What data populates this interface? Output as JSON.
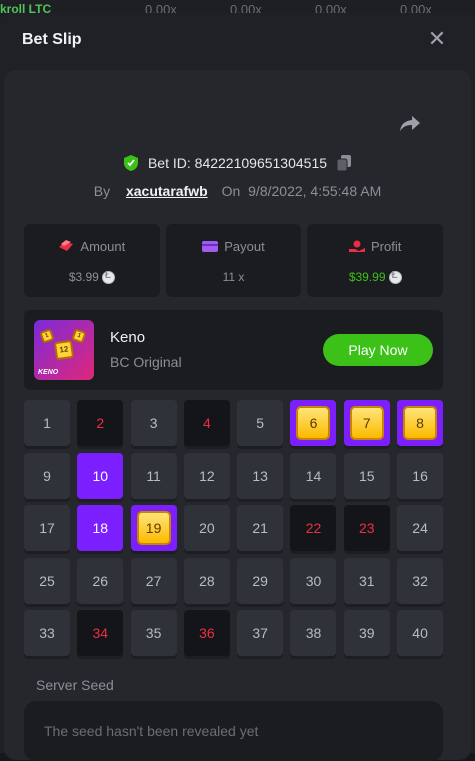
{
  "background": {
    "left_text": "kroll LTC",
    "multipliers": [
      "0.00x",
      "0.00x",
      "0.00x",
      "0.00x"
    ]
  },
  "modal": {
    "title": "Bet Slip",
    "close_icon": "close-icon"
  },
  "bet": {
    "id_label": "Bet ID: 84222109651304515",
    "by_label": "By",
    "user": "xacutarafwb",
    "on_label": "On",
    "datetime": "9/8/2022, 4:55:48 AM"
  },
  "stats": {
    "amount_label": "Amount",
    "amount_value": "$3.99",
    "payout_label": "Payout",
    "payout_value": "11 x",
    "profit_label": "Profit",
    "profit_value": "$39.99"
  },
  "game": {
    "name": "Keno",
    "subtitle": "BC Original",
    "play_label": "Play Now",
    "icon_text": "KENO",
    "icon_die_1": "12",
    "icon_die_2": "1",
    "icon_die_3": "1"
  },
  "grid": {
    "cells": [
      {
        "n": "1",
        "state": "normal"
      },
      {
        "n": "2",
        "state": "lost"
      },
      {
        "n": "3",
        "state": "normal"
      },
      {
        "n": "4",
        "state": "lost"
      },
      {
        "n": "5",
        "state": "normal"
      },
      {
        "n": "6",
        "state": "hit"
      },
      {
        "n": "7",
        "state": "hit"
      },
      {
        "n": "8",
        "state": "hit"
      },
      {
        "n": "9",
        "state": "normal"
      },
      {
        "n": "10",
        "state": "picked"
      },
      {
        "n": "11",
        "state": "normal"
      },
      {
        "n": "12",
        "state": "normal"
      },
      {
        "n": "13",
        "state": "normal"
      },
      {
        "n": "14",
        "state": "normal"
      },
      {
        "n": "15",
        "state": "normal"
      },
      {
        "n": "16",
        "state": "normal"
      },
      {
        "n": "17",
        "state": "normal"
      },
      {
        "n": "18",
        "state": "picked"
      },
      {
        "n": "19",
        "state": "hit"
      },
      {
        "n": "20",
        "state": "normal"
      },
      {
        "n": "21",
        "state": "normal"
      },
      {
        "n": "22",
        "state": "lost"
      },
      {
        "n": "23",
        "state": "lost"
      },
      {
        "n": "24",
        "state": "normal"
      },
      {
        "n": "25",
        "state": "normal"
      },
      {
        "n": "26",
        "state": "normal"
      },
      {
        "n": "27",
        "state": "normal"
      },
      {
        "n": "28",
        "state": "normal"
      },
      {
        "n": "29",
        "state": "normal"
      },
      {
        "n": "30",
        "state": "normal"
      },
      {
        "n": "31",
        "state": "normal"
      },
      {
        "n": "32",
        "state": "normal"
      },
      {
        "n": "33",
        "state": "normal"
      },
      {
        "n": "34",
        "state": "lost"
      },
      {
        "n": "35",
        "state": "normal"
      },
      {
        "n": "36",
        "state": "lost"
      },
      {
        "n": "37",
        "state": "normal"
      },
      {
        "n": "38",
        "state": "normal"
      },
      {
        "n": "39",
        "state": "normal"
      },
      {
        "n": "40",
        "state": "normal"
      }
    ]
  },
  "seed": {
    "label": "Server Seed",
    "placeholder": "The seed hasn't been revealed yet"
  },
  "colors": {
    "accent_green": "#3bc117",
    "picked_purple": "#7b1fff",
    "lost_red": "#ee2d45"
  }
}
